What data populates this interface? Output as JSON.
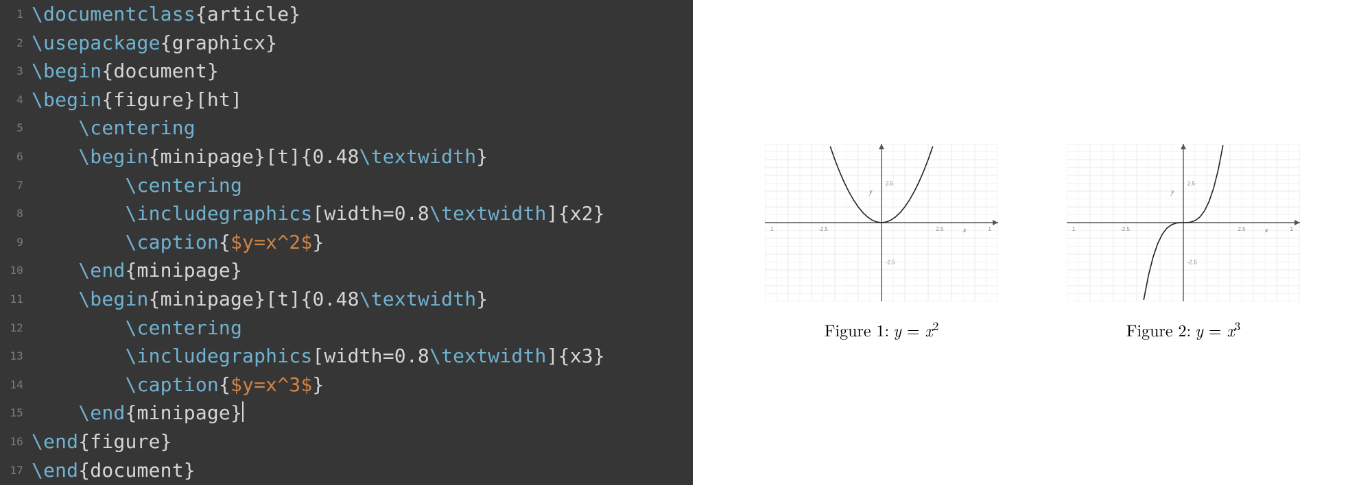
{
  "editor": {
    "line_count": 17,
    "lines": [
      {
        "indent": 0,
        "tokens": [
          {
            "t": "cmd",
            "v": "\\documentclass"
          },
          {
            "t": "punct",
            "v": "{"
          },
          {
            "t": "arg",
            "v": "article"
          },
          {
            "t": "punct",
            "v": "}"
          }
        ]
      },
      {
        "indent": 0,
        "tokens": [
          {
            "t": "cmd",
            "v": "\\usepackage"
          },
          {
            "t": "punct",
            "v": "{"
          },
          {
            "t": "arg",
            "v": "graphicx"
          },
          {
            "t": "punct",
            "v": "}"
          }
        ]
      },
      {
        "indent": 0,
        "tokens": [
          {
            "t": "cmd",
            "v": "\\begin"
          },
          {
            "t": "punct",
            "v": "{"
          },
          {
            "t": "arg",
            "v": "document"
          },
          {
            "t": "punct",
            "v": "}"
          }
        ]
      },
      {
        "indent": 0,
        "tokens": [
          {
            "t": "cmd",
            "v": "\\begin"
          },
          {
            "t": "punct",
            "v": "{"
          },
          {
            "t": "arg",
            "v": "figure"
          },
          {
            "t": "punct",
            "v": "}["
          },
          {
            "t": "arg",
            "v": "ht"
          },
          {
            "t": "punct",
            "v": "]"
          }
        ]
      },
      {
        "indent": 1,
        "tokens": [
          {
            "t": "cmd",
            "v": "\\centering"
          }
        ]
      },
      {
        "indent": 1,
        "tokens": [
          {
            "t": "cmd",
            "v": "\\begin"
          },
          {
            "t": "punct",
            "v": "{"
          },
          {
            "t": "arg",
            "v": "minipage"
          },
          {
            "t": "punct",
            "v": "}["
          },
          {
            "t": "arg",
            "v": "t"
          },
          {
            "t": "punct",
            "v": "]{"
          },
          {
            "t": "arg",
            "v": "0.48"
          },
          {
            "t": "cmd",
            "v": "\\textwidth"
          },
          {
            "t": "punct",
            "v": "}"
          }
        ]
      },
      {
        "indent": 2,
        "tokens": [
          {
            "t": "cmd",
            "v": "\\centering"
          }
        ]
      },
      {
        "indent": 2,
        "tokens": [
          {
            "t": "cmd",
            "v": "\\includegraphics"
          },
          {
            "t": "punct",
            "v": "["
          },
          {
            "t": "arg",
            "v": "width=0.8"
          },
          {
            "t": "cmd",
            "v": "\\textwidth"
          },
          {
            "t": "punct",
            "v": "]{"
          },
          {
            "t": "arg",
            "v": "x2"
          },
          {
            "t": "punct",
            "v": "}"
          }
        ]
      },
      {
        "indent": 2,
        "tokens": [
          {
            "t": "cmd",
            "v": "\\caption"
          },
          {
            "t": "punct",
            "v": "{"
          },
          {
            "t": "math",
            "v": "$y=x^2$"
          },
          {
            "t": "punct",
            "v": "}"
          }
        ]
      },
      {
        "indent": 1,
        "tokens": [
          {
            "t": "cmd",
            "v": "\\end"
          },
          {
            "t": "punct",
            "v": "{"
          },
          {
            "t": "arg",
            "v": "minipage"
          },
          {
            "t": "punct",
            "v": "}"
          }
        ]
      },
      {
        "indent": 1,
        "tokens": [
          {
            "t": "cmd",
            "v": "\\begin"
          },
          {
            "t": "punct",
            "v": "{"
          },
          {
            "t": "arg",
            "v": "minipage"
          },
          {
            "t": "punct",
            "v": "}["
          },
          {
            "t": "arg",
            "v": "t"
          },
          {
            "t": "punct",
            "v": "]{"
          },
          {
            "t": "arg",
            "v": "0.48"
          },
          {
            "t": "cmd",
            "v": "\\textwidth"
          },
          {
            "t": "punct",
            "v": "}"
          }
        ]
      },
      {
        "indent": 2,
        "tokens": [
          {
            "t": "cmd",
            "v": "\\centering"
          }
        ]
      },
      {
        "indent": 2,
        "tokens": [
          {
            "t": "cmd",
            "v": "\\includegraphics"
          },
          {
            "t": "punct",
            "v": "["
          },
          {
            "t": "arg",
            "v": "width=0.8"
          },
          {
            "t": "cmd",
            "v": "\\textwidth"
          },
          {
            "t": "punct",
            "v": "]{"
          },
          {
            "t": "arg",
            "v": "x3"
          },
          {
            "t": "punct",
            "v": "}"
          }
        ]
      },
      {
        "indent": 2,
        "tokens": [
          {
            "t": "cmd",
            "v": "\\caption"
          },
          {
            "t": "punct",
            "v": "{"
          },
          {
            "t": "math",
            "v": "$y=x^3$"
          },
          {
            "t": "punct",
            "v": "}"
          }
        ]
      },
      {
        "indent": 1,
        "tokens": [
          {
            "t": "cmd",
            "v": "\\end"
          },
          {
            "t": "punct",
            "v": "{"
          },
          {
            "t": "arg",
            "v": "minipage"
          },
          {
            "t": "punct",
            "v": "}"
          }
        ],
        "cursor_after": true
      },
      {
        "indent": 0,
        "tokens": [
          {
            "t": "cmd",
            "v": "\\end"
          },
          {
            "t": "punct",
            "v": "{"
          },
          {
            "t": "arg",
            "v": "figure"
          },
          {
            "t": "punct",
            "v": "}"
          }
        ]
      },
      {
        "indent": 0,
        "tokens": [
          {
            "t": "cmd",
            "v": "\\end"
          },
          {
            "t": "punct",
            "v": "{"
          },
          {
            "t": "arg",
            "v": "document"
          },
          {
            "t": "punct",
            "v": "}"
          }
        ]
      }
    ],
    "indent_unit": "    "
  },
  "preview": {
    "captions": {
      "fig1_prefix": "Figure 1: ",
      "fig1_var": "y",
      "fig1_eq": " = ",
      "fig1_base": "x",
      "fig1_exp": "2",
      "fig2_prefix": "Figure 2: ",
      "fig2_var": "y",
      "fig2_eq": " = ",
      "fig2_base": "x",
      "fig2_exp": "3"
    },
    "axis_ticks": {
      "x": [
        "1",
        "-2.5",
        "2.5",
        "1"
      ],
      "ytop": "2.5",
      "ybot": "-2.5",
      "xlabel": "x",
      "ylabel": "y"
    }
  },
  "chart_data": [
    {
      "type": "line",
      "title": "y = x^2",
      "xlabel": "x",
      "ylabel": "y",
      "xlim": [
        -5,
        5
      ],
      "ylim": [
        -5,
        5
      ],
      "xticks": [
        -2.5,
        2.5
      ],
      "yticks": [
        -2.5,
        2.5
      ],
      "series": [
        {
          "name": "y=x^2",
          "x": [
            -2.2,
            -2.0,
            -1.8,
            -1.6,
            -1.4,
            -1.2,
            -1.0,
            -0.8,
            -0.6,
            -0.4,
            -0.2,
            0,
            0.2,
            0.4,
            0.6,
            0.8,
            1.0,
            1.2,
            1.4,
            1.6,
            1.8,
            2.0,
            2.2
          ],
          "y": [
            4.84,
            4.0,
            3.24,
            2.56,
            1.96,
            1.44,
            1.0,
            0.64,
            0.36,
            0.16,
            0.04,
            0,
            0.04,
            0.16,
            0.36,
            0.64,
            1.0,
            1.44,
            1.96,
            2.56,
            3.24,
            4.0,
            4.84
          ]
        }
      ]
    },
    {
      "type": "line",
      "title": "y = x^3",
      "xlabel": "x",
      "ylabel": "y",
      "xlim": [
        -5,
        5
      ],
      "ylim": [
        -5,
        5
      ],
      "xticks": [
        -2.5,
        2.5
      ],
      "yticks": [
        -2.5,
        2.5
      ],
      "series": [
        {
          "name": "y=x^3",
          "x": [
            -1.7,
            -1.5,
            -1.3,
            -1.1,
            -0.9,
            -0.7,
            -0.5,
            -0.3,
            -0.1,
            0,
            0.1,
            0.3,
            0.5,
            0.7,
            0.9,
            1.1,
            1.3,
            1.5,
            1.7
          ],
          "y": [
            -4.91,
            -3.38,
            -2.2,
            -1.33,
            -0.73,
            -0.34,
            -0.13,
            -0.027,
            -0.001,
            0,
            0.001,
            0.027,
            0.13,
            0.34,
            0.73,
            1.33,
            2.2,
            3.38,
            4.91
          ]
        }
      ]
    }
  ]
}
